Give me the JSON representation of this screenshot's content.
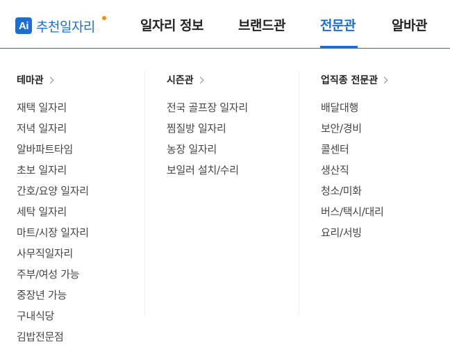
{
  "brand": {
    "badge": "Ai",
    "label": "추천일자리"
  },
  "tabs": [
    {
      "label": "일자리 정보",
      "active": false
    },
    {
      "label": "브랜드관",
      "active": false
    },
    {
      "label": "전문관",
      "active": true
    },
    {
      "label": "알바관",
      "active": false
    }
  ],
  "columns": [
    {
      "title": "테마관",
      "items": [
        "재택 일자리",
        "저녁 일자리",
        "알바파트타임",
        "초보 일자리",
        "간호/요양 일자리",
        "세탁 일자리",
        "마트/시장 일자리",
        "사무직일자리",
        "주부/여성 가능",
        "중장년 가능",
        "구내식당",
        "김밥전문점"
      ]
    },
    {
      "title": "시즌관",
      "items": [
        "전국 골프장 일자리",
        "찜질방 일자리",
        "농장 일자리",
        "보일러 설치/수리"
      ]
    },
    {
      "title": "업직종 전문관",
      "items": [
        "배달대행",
        "보안/경비",
        "콜센터",
        "생산직",
        "청소/미화",
        "버스/택시/대리",
        "요리/서빙"
      ]
    }
  ],
  "colors": {
    "accent": "#1a6fd1",
    "dot": "#ff8a00"
  }
}
